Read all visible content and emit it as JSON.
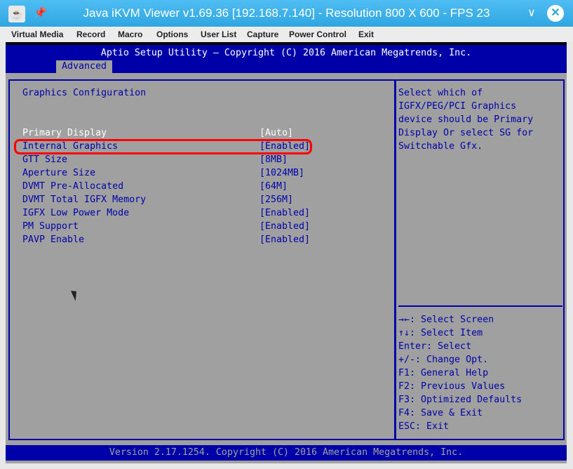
{
  "window": {
    "title": "Java iKVM Viewer v1.69.36 [192.168.7.140] - Resolution 800 X 600 - FPS 23"
  },
  "menu": [
    "Virtual Media",
    "Record",
    "Macro",
    "Options",
    "User List",
    "Capture",
    "Power Control",
    "Exit"
  ],
  "bios": {
    "header": "Aptio Setup Utility – Copyright (C) 2016 American Megatrends, Inc.",
    "tab": "Advanced",
    "section_title": "Graphics Configuration",
    "items": [
      {
        "label": "Primary Display",
        "value": "[Auto]"
      },
      {
        "label": "Internal Graphics",
        "value": "[Enabled]"
      },
      {
        "label": "GTT Size",
        "value": "[8MB]"
      },
      {
        "label": "Aperture Size",
        "value": "[1024MB]"
      },
      {
        "label": "DVMT Pre-Allocated",
        "value": "[64M]"
      },
      {
        "label": "DVMT Total IGFX Memory",
        "value": "[256M]"
      },
      {
        "label": "IGFX Low Power Mode",
        "value": "[Enabled]"
      },
      {
        "label": "PM Support",
        "value": "[Enabled]"
      },
      {
        "label": "PAVP Enable",
        "value": "[Enabled]"
      }
    ],
    "help": [
      "Select which of",
      "IGFX/PEG/PCI Graphics",
      "device should be Primary",
      "Display Or select SG for",
      "Switchable Gfx."
    ],
    "keys": [
      "→←: Select Screen",
      "↑↓: Select Item",
      "Enter: Select",
      "+/-: Change Opt.",
      "F1: General Help",
      "F2: Previous Values",
      "F3: Optimized Defaults",
      "F4: Save & Exit",
      "ESC: Exit"
    ],
    "footer": "Version 2.17.1254. Copyright (C) 2016 American Megatrends, Inc."
  },
  "colors": {
    "bios_blue": "#0000a8",
    "bios_gray": "#a0a0a0",
    "highlight": "#ff0000",
    "titlebar": "#3daee9"
  }
}
